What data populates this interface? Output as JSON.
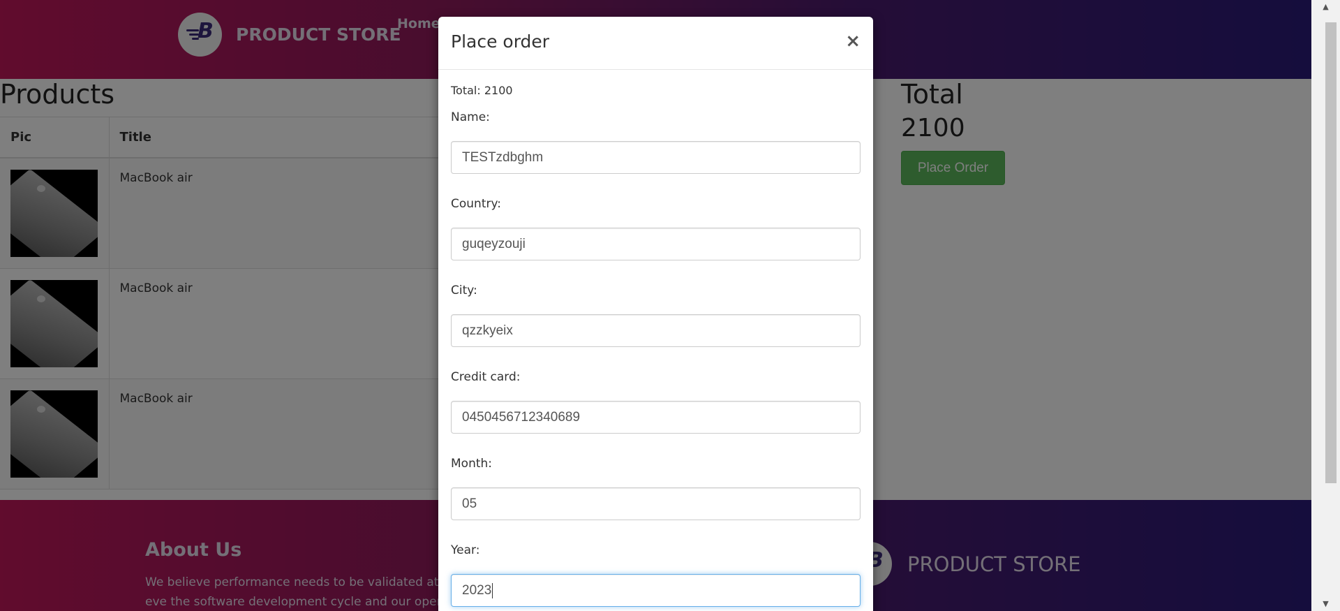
{
  "navbar": {
    "brand": "PRODUCT STORE",
    "home": "Home"
  },
  "main": {
    "products_title": "Products",
    "columns": [
      "Pic",
      "Title"
    ],
    "rows": [
      {
        "title": "MacBook air"
      },
      {
        "title": "MacBook air"
      },
      {
        "title": "MacBook air"
      }
    ],
    "total_title": "Total",
    "total_value": "2100",
    "place_order": "Place Order"
  },
  "footer": {
    "about_title": "About Us",
    "about_text": "We believe performance needs to be validated at eve the software development cycle and our open source",
    "brand": "PRODUCT STORE"
  },
  "modal": {
    "title": "Place order",
    "close": "×",
    "total_line": "Total: 2100",
    "fields": {
      "name_label": "Name:",
      "name_value": "TESTzdbghm",
      "country_label": "Country:",
      "country_value": "guqeyzouji",
      "city_label": "City:",
      "city_value": "qzzkyeix",
      "card_label": "Credit card:",
      "card_value": "0450456712340689",
      "month_label": "Month:",
      "month_value": "05",
      "year_label": "Year:",
      "year_value": "2023"
    }
  }
}
